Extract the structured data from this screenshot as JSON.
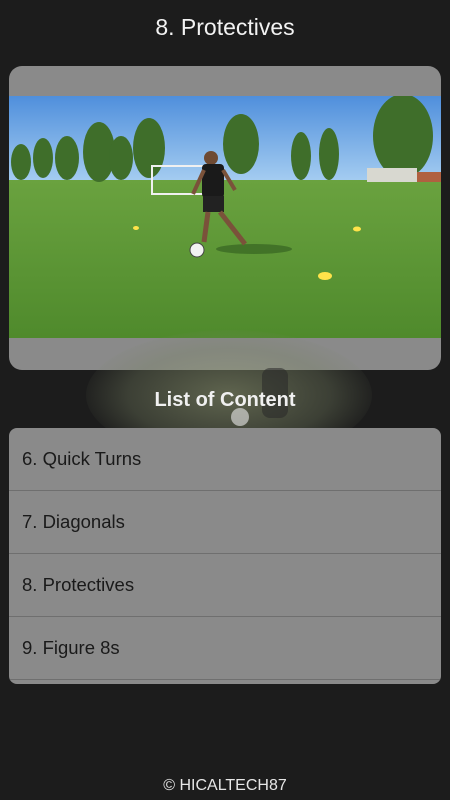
{
  "header": {
    "title": "8. Protectives"
  },
  "video": {
    "kind": "soccer-drill-video-thumbnail"
  },
  "list": {
    "heading": "List of Content",
    "items": [
      {
        "label": "6. Quick Turns"
      },
      {
        "label": "7. Diagonals"
      },
      {
        "label": "8. Protectives"
      },
      {
        "label": "9. Figure 8s"
      }
    ]
  },
  "footer": {
    "copyright": "© HICALTECH87"
  },
  "colors": {
    "background": "#1c1c1c",
    "card": "#8a8a8a",
    "grass": "#5f9a3a",
    "sky": "#7fb4ea"
  }
}
